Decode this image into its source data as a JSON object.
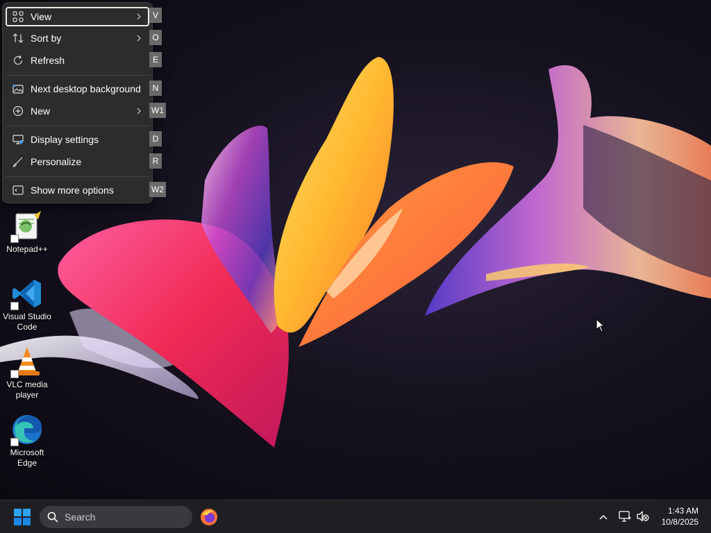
{
  "context_menu": {
    "items": [
      {
        "label": "View",
        "icon": "grid-icon",
        "submenu": true,
        "access_key": "V"
      },
      {
        "label": "Sort by",
        "icon": "sort-icon",
        "submenu": true,
        "access_key": "O"
      },
      {
        "label": "Refresh",
        "icon": "refresh-icon",
        "submenu": false,
        "access_key": "E"
      },
      {
        "label": "Next desktop background",
        "icon": "next-background-icon",
        "submenu": false,
        "access_key": "N"
      },
      {
        "label": "New",
        "icon": "new-icon",
        "submenu": true,
        "access_key": "W1"
      },
      {
        "label": "Display settings",
        "icon": "display-icon",
        "submenu": false,
        "access_key": "D"
      },
      {
        "label": "Personalize",
        "icon": "brush-icon",
        "submenu": false,
        "access_key": "R"
      },
      {
        "label": "Show more options",
        "icon": "more-options-icon",
        "submenu": false,
        "access_key": "W2"
      }
    ]
  },
  "desktop_icons": [
    {
      "label": "Notepad++",
      "icon": "notepad-plus-plus-icon"
    },
    {
      "label": "Visual Studio Code",
      "icon": "vscode-icon"
    },
    {
      "label": "VLC media player",
      "icon": "vlc-icon"
    },
    {
      "label": "Microsoft Edge",
      "icon": "edge-icon"
    }
  ],
  "taskbar": {
    "search_label": "Search",
    "time": "1:43 AM",
    "date": "10/8/2025",
    "pinned": [
      "firefox-icon"
    ],
    "tray_icons": [
      "chevron-up-icon",
      "network-icon",
      "volume-muted-icon"
    ]
  },
  "colors": {
    "menu_bg": "#2c2c2c",
    "taskbar_bg": "#1f1f23",
    "windows_blue": "#0078d4",
    "key_tip_bg": "#6a6a6a"
  }
}
